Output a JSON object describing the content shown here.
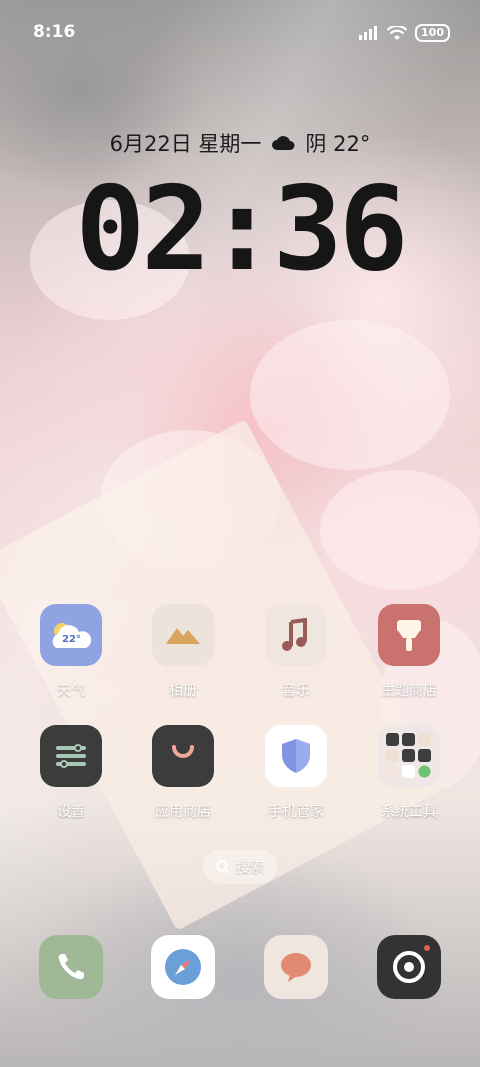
{
  "status_bar": {
    "time": "8:16",
    "battery": "100"
  },
  "lock_info": {
    "date": "6月22日 星期一",
    "weather_text": "阴 22°"
  },
  "clock": {
    "time": "02:36"
  },
  "apps": [
    {
      "label": "天气",
      "icon": "weather-icon",
      "badge": "22°"
    },
    {
      "label": "相册",
      "icon": "gallery-icon"
    },
    {
      "label": "音乐",
      "icon": "music-icon"
    },
    {
      "label": "主题商店",
      "icon": "theme-store-icon"
    },
    {
      "label": "设置",
      "icon": "settings-icon"
    },
    {
      "label": "应用商店",
      "icon": "app-store-icon"
    },
    {
      "label": "手机管家",
      "icon": "phone-manager-icon"
    },
    {
      "label": "系统工具",
      "icon": "system-tools-folder-icon"
    }
  ],
  "search": {
    "label": "搜索"
  },
  "dock": [
    {
      "icon": "phone-icon"
    },
    {
      "icon": "browser-icon"
    },
    {
      "icon": "messages-icon"
    },
    {
      "icon": "camera-icon"
    }
  ],
  "colors": {
    "weather": "#8fa3e3",
    "gallery": "#ece3dc",
    "music": "#efe6e0",
    "theme": "#c9726e",
    "settings": "#3c3c3c",
    "store": "#3c3c3c",
    "manager": "#ffffff",
    "phone": "#9fb996",
    "camera": "#333333"
  }
}
